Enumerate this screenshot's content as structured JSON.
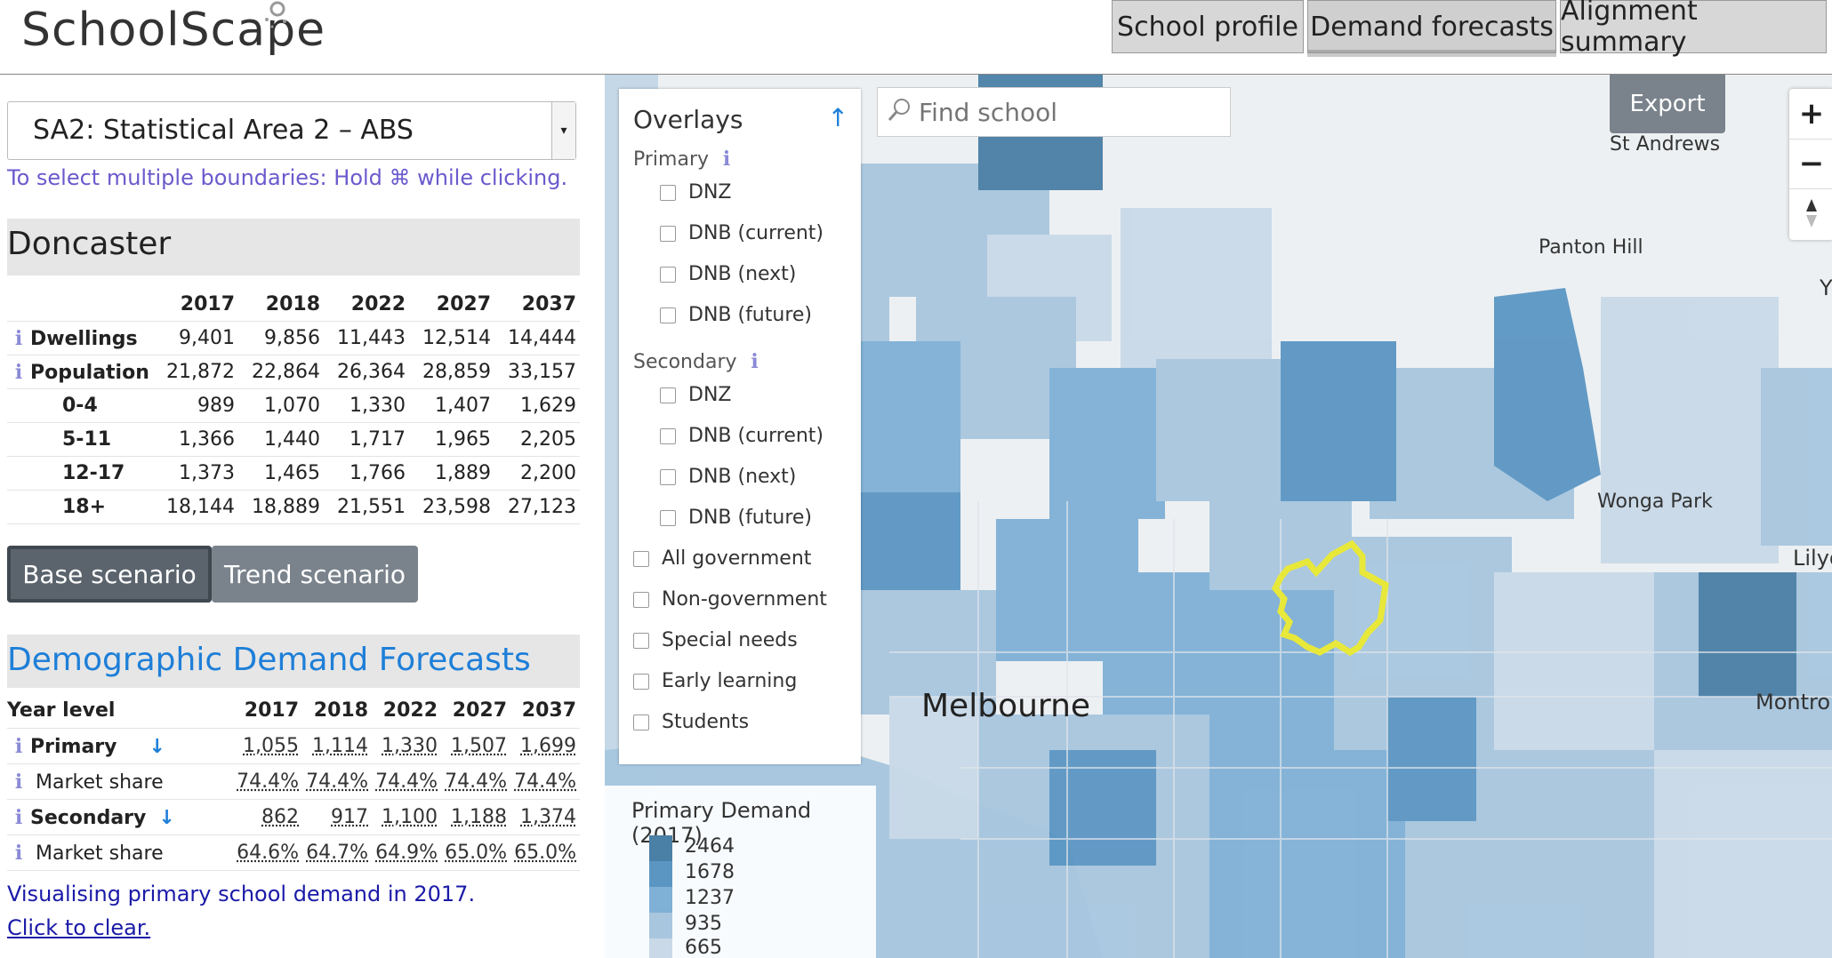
{
  "app": {
    "name": "SchoolScape"
  },
  "nav": {
    "tabs": [
      {
        "label": "School profile"
      },
      {
        "label": "Demand forecasts"
      },
      {
        "label": "Alignment summary"
      }
    ]
  },
  "sidebar": {
    "boundary_select": "SA2: Statistical Area 2 – ABS",
    "select_hint": "To select multiple boundaries: Hold ⌘ while clicking.",
    "region_title": "Doncaster",
    "population_table": {
      "years": [
        "2017",
        "2018",
        "2022",
        "2027",
        "2037"
      ],
      "rows": [
        {
          "label": "Dwellings",
          "info": true,
          "values": [
            "9,401",
            "9,856",
            "11,443",
            "12,514",
            "14,444"
          ]
        },
        {
          "label": "Population",
          "info": true,
          "values": [
            "21,872",
            "22,864",
            "26,364",
            "28,859",
            "33,157"
          ]
        },
        {
          "label": "0-4",
          "info": false,
          "values": [
            "989",
            "1,070",
            "1,330",
            "1,407",
            "1,629"
          ]
        },
        {
          "label": "5-11",
          "info": false,
          "values": [
            "1,366",
            "1,440",
            "1,717",
            "1,965",
            "2,205"
          ]
        },
        {
          "label": "12-17",
          "info": false,
          "values": [
            "1,373",
            "1,465",
            "1,766",
            "1,889",
            "2,200"
          ]
        },
        {
          "label": "18+",
          "info": false,
          "values": [
            "18,144",
            "18,889",
            "21,551",
            "23,598",
            "27,123"
          ]
        }
      ]
    },
    "scenarios": {
      "base": "Base scenario",
      "trend": "Trend scenario"
    },
    "demand_title": "Demographic Demand Forecasts",
    "demand_table": {
      "header_label": "Year level",
      "years": [
        "2017",
        "2018",
        "2022",
        "2027",
        "2037"
      ],
      "rows": [
        {
          "label": "Primary",
          "bold": true,
          "values": [
            "1,055",
            "1,114",
            "1,330",
            "1,507",
            "1,699"
          ]
        },
        {
          "label": "Market share",
          "bold": false,
          "values": [
            "74.4%",
            "74.4%",
            "74.4%",
            "74.4%",
            "74.4%"
          ]
        },
        {
          "label": "Secondary",
          "bold": true,
          "values": [
            "862",
            "917",
            "1,100",
            "1,188",
            "1,374"
          ]
        },
        {
          "label": "Market share",
          "bold": false,
          "values": [
            "64.6%",
            "64.7%",
            "64.9%",
            "65.0%",
            "65.0%"
          ]
        }
      ]
    },
    "vis_note": "Visualising primary school demand in 2017.",
    "clear_link": "Click to clear."
  },
  "map": {
    "overlays": {
      "title": "Overlays",
      "primary_label": "Primary",
      "primary_items": [
        "DNZ",
        "DNB (current)",
        "DNB (next)",
        "DNB (future)"
      ],
      "secondary_label": "Secondary",
      "secondary_items": [
        "DNZ",
        "DNB (current)",
        "DNB (next)",
        "DNB (future)"
      ],
      "other_items": [
        "All government",
        "Non-government",
        "Special needs",
        "Early learning",
        "Students"
      ]
    },
    "search_placeholder": "Find school",
    "export_label": "Export",
    "zoom": {
      "in": "+",
      "out": "−"
    },
    "places": {
      "st_andrews": "St Andrews",
      "panton_hill": "Panton Hill",
      "wonga_park": "Wonga Park",
      "lilydale": "Lilyd",
      "montrose": "Montro",
      "y_cut": "Y",
      "melbourne": "Melbourne"
    },
    "legend": {
      "title": "Primary Demand (2017)",
      "items": [
        {
          "label": "2464",
          "color": "#4a7fa6"
        },
        {
          "label": "1678",
          "color": "#5b96c3"
        },
        {
          "label": "1237",
          "color": "#7fb0d6"
        },
        {
          "label": "935",
          "color": "#a8c6de"
        },
        {
          "label": "665",
          "color": "#c9d9e8"
        }
      ]
    },
    "selection_color": "#e8e83a"
  }
}
